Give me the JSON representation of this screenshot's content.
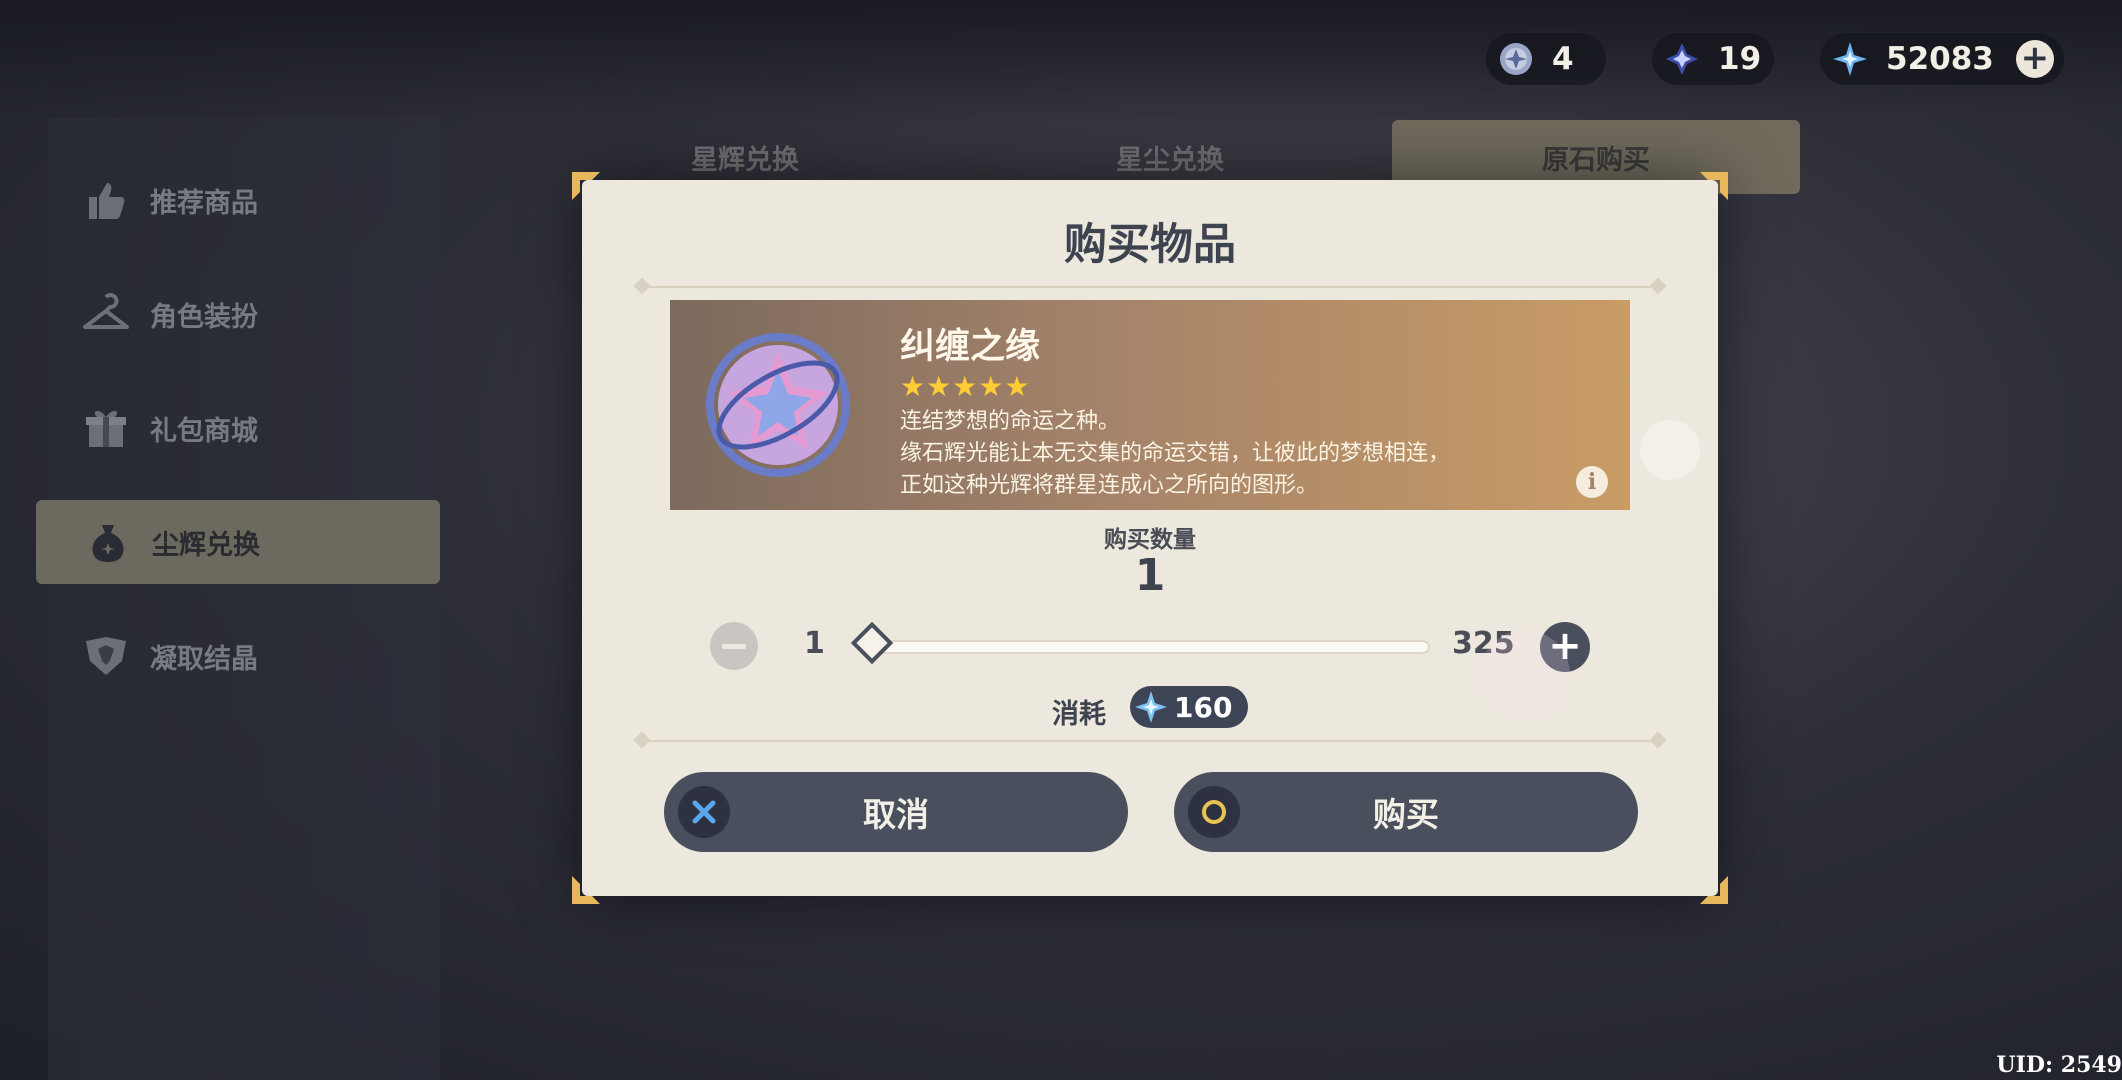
{
  "currencies": [
    {
      "icon": "acquaint-fate-icon",
      "value": "4"
    },
    {
      "icon": "masterless-starglitter-icon",
      "value": "19"
    },
    {
      "icon": "masterless-stardust-icon",
      "value": "52083"
    }
  ],
  "sidebar": {
    "items": [
      {
        "label": "推荐商品",
        "icon": "thumbs-up-icon"
      },
      {
        "label": "角色装扮",
        "icon": "hanger-icon"
      },
      {
        "label": "礼包商城",
        "icon": "gift-icon"
      },
      {
        "label": "尘辉兑换",
        "icon": "pouch-icon",
        "active": true
      },
      {
        "label": "凝取结晶",
        "icon": "crystal-icon"
      }
    ]
  },
  "tabs": [
    {
      "label": "星辉兑换"
    },
    {
      "label": "星尘兑换"
    },
    {
      "label": "原石购买",
      "active": true
    }
  ],
  "modal": {
    "title": "购买物品",
    "item": {
      "name": "纠缠之缘",
      "stars": "★★★★★",
      "description_lines": [
        "连结梦想的命运之种。",
        "缘石辉光能让本无交集的命运交错，让彼此的梦想相连，",
        "正如这种光辉将群星连成心之所向的图形。"
      ],
      "icon": "intertwined-fate-icon"
    },
    "quantity_label": "购买数量",
    "quantity": "1",
    "slider": {
      "min": "1",
      "max": "325",
      "value": 1
    },
    "cost_label": "消耗",
    "cost_value": "160",
    "cancel_label": "取消",
    "buy_label": "购买"
  },
  "uid": "UID: 2549"
}
